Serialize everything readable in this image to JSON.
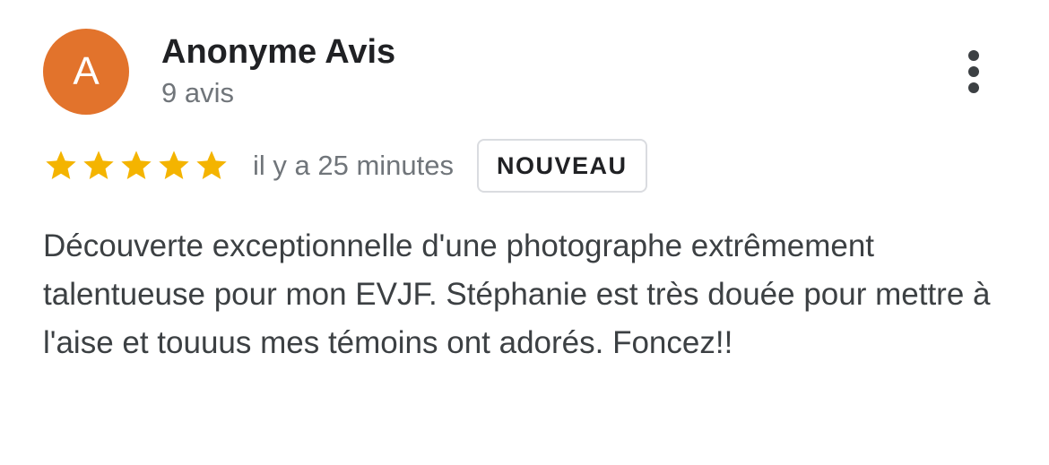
{
  "reviewer": {
    "initial": "A",
    "name": "Anonyme Avis",
    "review_count": "9 avis",
    "avatar_color": "#e2732c"
  },
  "review": {
    "rating": 5,
    "max_rating": 5,
    "timestamp": "il y a 25 minutes",
    "badge": "NOUVEAU",
    "text": "Découverte exceptionnelle d'une photographe extrêmement talentueuse pour mon EVJF. Stéphanie est très douée pour mettre à l'aise et touuus mes témoins ont adorés. Foncez!!"
  },
  "icons": {
    "more": "more-vert-icon",
    "star": "star-icon"
  },
  "colors": {
    "star": "#f4b400",
    "name": "#202124",
    "secondary": "#70757a",
    "body": "#3c4043",
    "badge_border": "#dadce0"
  }
}
